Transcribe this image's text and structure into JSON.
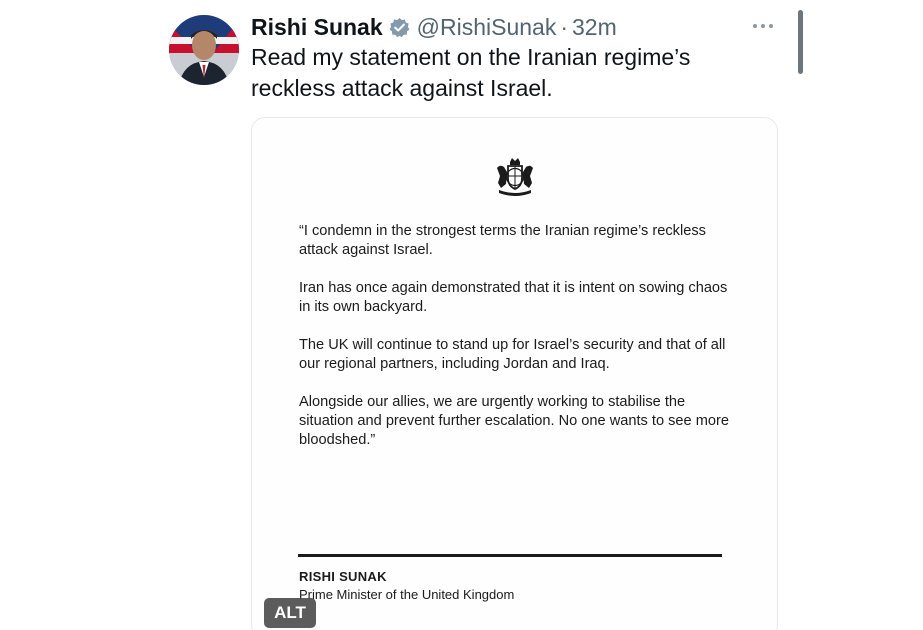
{
  "tweet": {
    "author_name": "Rishi Sunak",
    "handle": "@RishiSunak",
    "separator": "·",
    "time": "32m",
    "text": "Read my statement on the Iranian regime’s reckless attack against Israel.",
    "verified_icon": "verified-badge-icon",
    "more_icon": "more-options-icon"
  },
  "media": {
    "crest_icon": "royal-coat-of-arms-icon",
    "paragraphs": [
      "“I condemn in the strongest terms the Iranian regime’s reckless attack against Israel.",
      "Iran has once again demonstrated that it is intent on sowing chaos in its own backyard.",
      "The UK will continue to stand up for Israel’s security and that of all our regional partners, including Jordan and Iraq.",
      "Alongside our allies, we are urgently working to stabilise the situation and prevent further escalation. No one wants to see more bloodshed.”"
    ],
    "signatory_name": "RISHI SUNAK",
    "signatory_title": "Prime Minister of the United Kingdom",
    "alt_label": "ALT"
  },
  "colors": {
    "text_primary": "#0f1419",
    "text_secondary": "#536471",
    "verified": "#829aab",
    "alt_badge": "#464646"
  }
}
